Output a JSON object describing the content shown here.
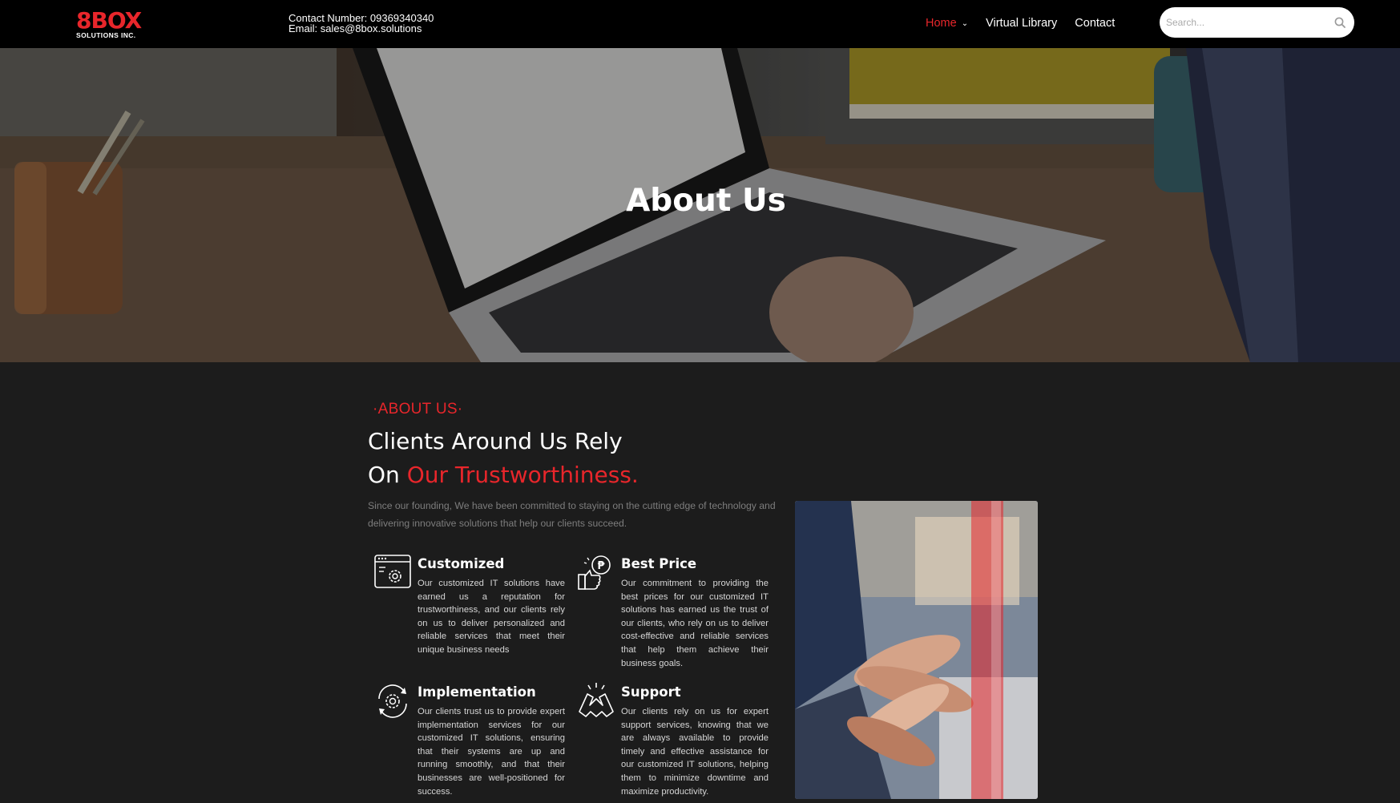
{
  "header": {
    "logo_mark": "8BOX",
    "logo_sub": "SOLUTIONS INC.",
    "contact_number": "Contact Number: 09369340340",
    "email": "Email: sales@8box.solutions",
    "nav": [
      {
        "label": "Home",
        "active": true
      },
      {
        "label": "Virtual Library",
        "active": false
      },
      {
        "label": "Contact",
        "active": false
      }
    ],
    "search_placeholder": "Search..."
  },
  "hero": {
    "title": "About Us"
  },
  "about": {
    "eyebrow": "·ABOUT US·",
    "headline_line1": "Clients Around Us Rely",
    "headline_line2_prefix": "On ",
    "headline_line2_highlight": "Our Trustworthiness.",
    "intro": "Since our founding, We have been committed to staying on the cutting edge of technology and delivering innovative solutions that help our clients succeed.",
    "features": [
      {
        "icon": "settings-window-icon",
        "title": "Customized",
        "text": "Our customized IT solutions have earned us a reputation for trustworthiness, and our clients rely on us to deliver personalized and reliable services that meet their unique business needs"
      },
      {
        "icon": "thumbs-up-price-icon",
        "title": "Best Price",
        "text": "Our commitment to providing the best prices for our customized IT solutions has earned us the trust of our clients, who rely on us to deliver cost-effective and reliable services that help them achieve their business goals."
      },
      {
        "icon": "gear-cycle-icon",
        "title": "Implementation",
        "text": "Our clients trust us to provide expert implementation services for our customized IT solutions, ensuring that their systems are up and running smoothly, and that their businesses are well-positioned for success."
      },
      {
        "icon": "handshake-icon",
        "title": "Support",
        "text": "Our clients rely on us for expert support services, knowing that we are always available to provide timely and effective assistance for our customized IT solutions, helping them to minimize downtime and maximize productivity."
      }
    ]
  },
  "colors": {
    "accent": "#e8262b",
    "background": "#1c1c1c",
    "header": "#000000"
  }
}
